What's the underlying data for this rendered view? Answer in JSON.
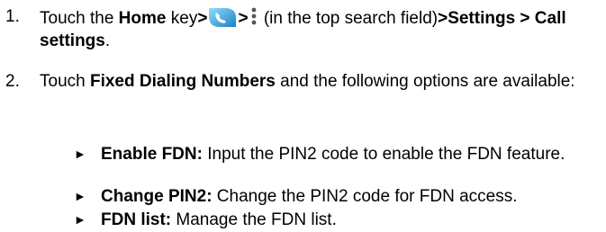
{
  "steps": [
    {
      "number": "1.",
      "text_touch": "Touch the ",
      "home": "Home",
      "text_key": " key",
      "gt1": ">",
      "gt2": ">",
      "after_menu": " (in the top search field)",
      "gt_settings": ">Settings > Call settings",
      "period": "."
    },
    {
      "number": "2.",
      "text_touch": "Touch ",
      "fdn": "Fixed Dialing Numbers",
      "rest": " and the following options are available:"
    }
  ],
  "options": [
    {
      "marker": "►",
      "title": "Enable FDN:",
      "desc": " Input the PIN2 code to enable the FDN feature."
    },
    {
      "marker": "►",
      "title": "Change PIN2:",
      "desc": " Change the PIN2 code for FDN access."
    },
    {
      "marker": "►",
      "title": "FDN list:",
      "desc": " Manage the FDN list."
    }
  ],
  "icons": {
    "phone": "phone-app-icon",
    "menu": "more-options-icon"
  },
  "colors": {
    "phone_icon_light": "#7fd3f5",
    "phone_icon_dark": "#1e88c8"
  }
}
